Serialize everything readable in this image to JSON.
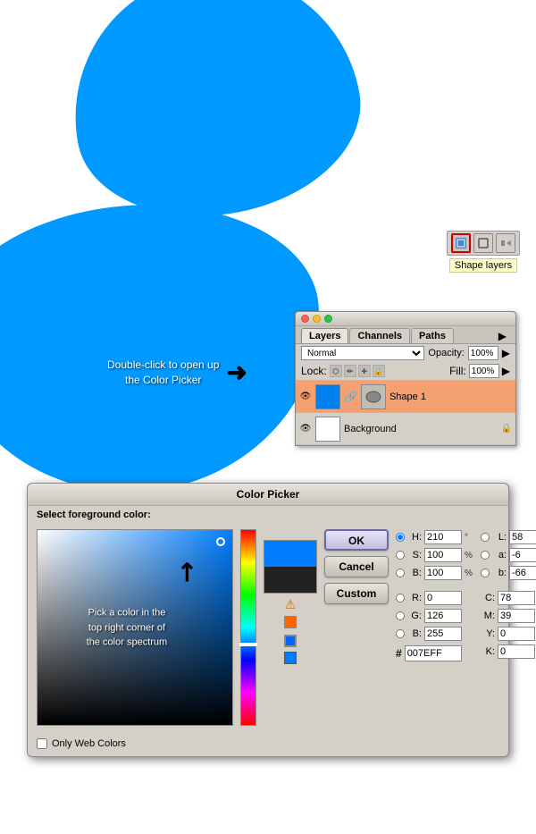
{
  "canvas": {
    "blob_color": "#0099ff"
  },
  "shape_layers_tip": {
    "label": "Shape layers"
  },
  "layers_panel": {
    "title": "",
    "tabs": [
      "Layers",
      "Channels",
      "Paths"
    ],
    "active_tab": "Layers",
    "blend_mode": "Normal",
    "opacity_label": "Opacity:",
    "opacity_value": "100%",
    "lock_label": "Lock:",
    "fill_label": "Fill:",
    "fill_value": "100%",
    "layers": [
      {
        "name": "Shape 1",
        "visible": true,
        "active": true,
        "type": "shape"
      },
      {
        "name": "Background",
        "visible": true,
        "active": false,
        "type": "bg"
      }
    ]
  },
  "instruction": {
    "line1": "Double-click to open up",
    "line2": "the Color Picker"
  },
  "color_picker": {
    "title": "Color Picker",
    "subtitle": "Select foreground color:",
    "spectrum_note_line1": "Pick a color in the",
    "spectrum_note_line2": "top right corner of",
    "spectrum_note_line3": "the color spectrum",
    "buttons": {
      "ok": "OK",
      "cancel": "Cancel",
      "custom": "Custom"
    },
    "fields": {
      "h_label": "H:",
      "h_value": "210",
      "h_unit": "°",
      "s_label": "S:",
      "s_value": "100",
      "s_unit": "%",
      "b_label": "B:",
      "b_value": "100",
      "b_unit": "%",
      "r_label": "R:",
      "r_value": "0",
      "r_unit": "",
      "g_label": "G:",
      "g_value": "126",
      "g_unit": "",
      "b2_label": "B:",
      "b2_value": "255",
      "b2_unit": "",
      "l_label": "L:",
      "l_value": "58",
      "l_unit": "",
      "a_label": "a:",
      "a_value": "-6",
      "a_unit": "",
      "b3_label": "b:",
      "b3_value": "-66",
      "b3_unit": "",
      "c_label": "C:",
      "c_value": "78",
      "c_unit": "%",
      "m_label": "M:",
      "m_value": "39",
      "m_unit": "%",
      "y_label": "Y:",
      "y_value": "0",
      "y_unit": "%",
      "k_label": "K:",
      "k_value": "0",
      "k_unit": "%",
      "hex_label": "#",
      "hex_value": "007EFF"
    },
    "only_web_colors": "Only Web Colors"
  }
}
